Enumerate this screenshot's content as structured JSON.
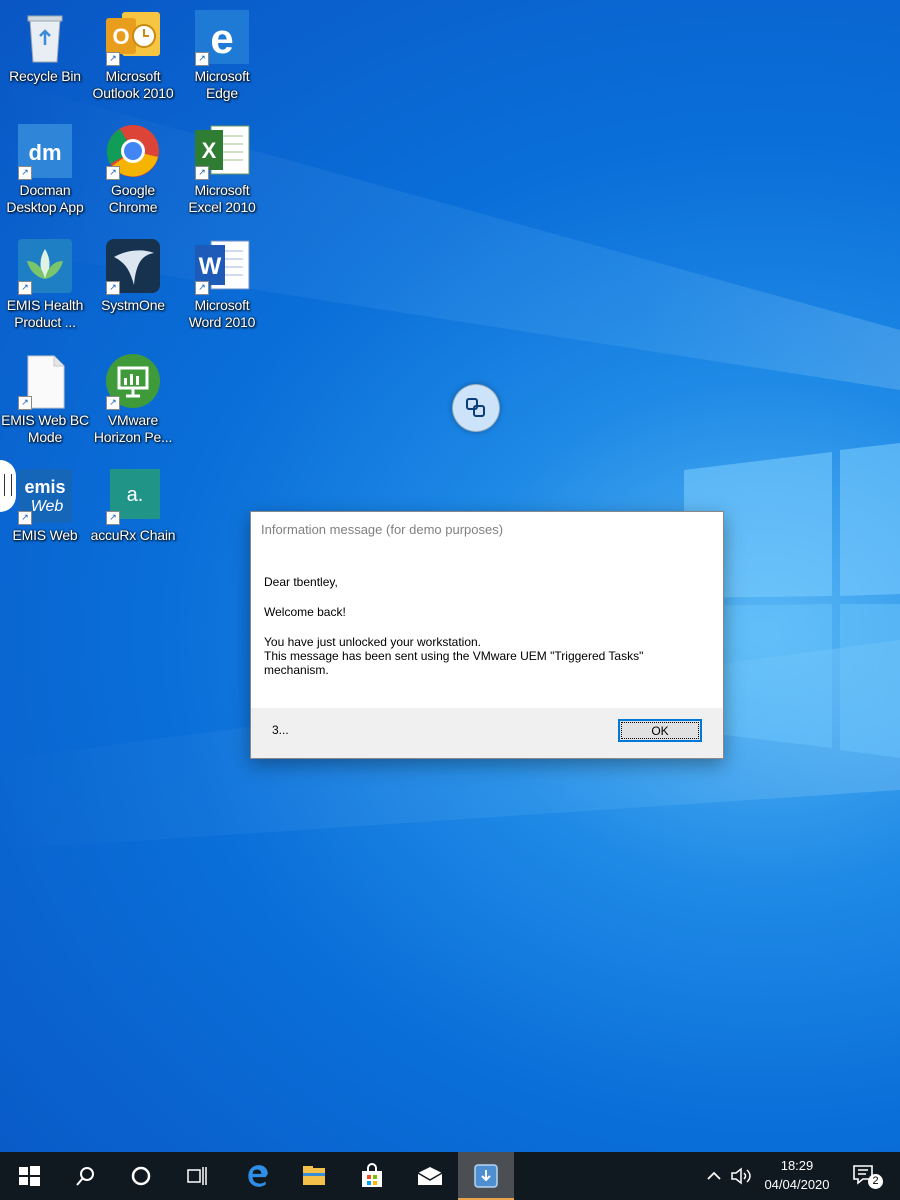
{
  "desktop": {
    "icons": [
      {
        "name": "recycle-bin",
        "label": "Recycle Bin"
      },
      {
        "name": "outlook",
        "label": "Microsoft Outlook 2010"
      },
      {
        "name": "edge",
        "label": "Microsoft Edge"
      },
      {
        "name": "docman",
        "label": "Docman Desktop App"
      },
      {
        "name": "chrome",
        "label": "Google Chrome"
      },
      {
        "name": "excel",
        "label": "Microsoft Excel 2010"
      },
      {
        "name": "emis-health",
        "label": "EMIS Health Product ..."
      },
      {
        "name": "systmone",
        "label": "SystmOne"
      },
      {
        "name": "word",
        "label": "Microsoft Word 2010"
      },
      {
        "name": "emis-bc",
        "label": "EMIS Web BC Mode"
      },
      {
        "name": "vmware-horizon",
        "label": "VMware Horizon Pe..."
      },
      {
        "name": "emis-web",
        "label": "EMIS Web"
      },
      {
        "name": "accurx",
        "label": "accuRx Chain"
      }
    ]
  },
  "dialog": {
    "title": "Information message (for demo purposes)",
    "greeting": "Dear tbentley,",
    "welcome": "Welcome back!",
    "line1": "You have just unlocked your workstation.",
    "line2": "This message has been sent using the VMware UEM \"Triggered Tasks\"",
    "line3": "mechanism.",
    "countdown": "3...",
    "ok_label": "OK"
  },
  "taskbar": {
    "time": "18:29",
    "date": "04/04/2020",
    "notification_count": "2",
    "items": [
      "windows-start-icon",
      "search-icon",
      "cortana-icon",
      "task-view-icon",
      "edge-icon",
      "file-explorer-icon",
      "store-icon",
      "mail-icon",
      "vmware-app-icon"
    ]
  },
  "colors": {
    "desktop_blue": "#0a6fd9",
    "taskbar": "#101820",
    "dialog_accent": "#0078d7"
  }
}
